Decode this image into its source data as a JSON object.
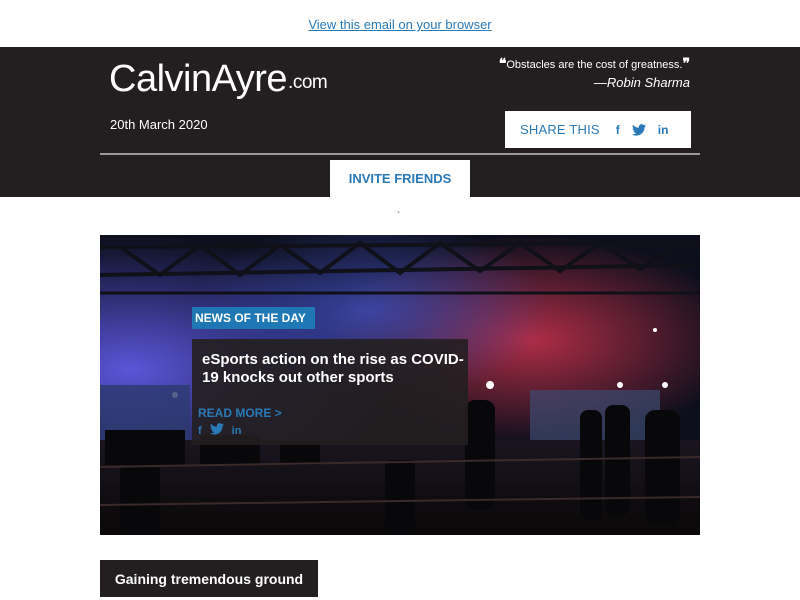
{
  "top": {
    "view_in_browser": "View this email on your browser"
  },
  "header": {
    "logo_main": "CalvinAyre",
    "logo_suffix": ".com",
    "quote_text": "Obstacles are the cost of greatness.",
    "quote_open": "❝",
    "quote_close": "❞",
    "quote_author": "—Robin Sharma",
    "date": "20th March 2020",
    "share_label": "SHARE THIS",
    "invite_label": "INVITE FRIENDS"
  },
  "icons": {
    "facebook": "f",
    "twitter": "twitter-icon",
    "linkedin": "in"
  },
  "misc": {
    "tick": "`"
  },
  "hero": {
    "tag": "NEWS OF THE DAY",
    "title": "eSports action on the rise as COVID-19 knocks out other sports",
    "read_more": "READ MORE >"
  },
  "section": {
    "button_label": "Gaining tremendous ground"
  },
  "colors": {
    "accent": "#2a7ab8",
    "dark": "#231f20",
    "tag_blue": "#1f77b4"
  }
}
